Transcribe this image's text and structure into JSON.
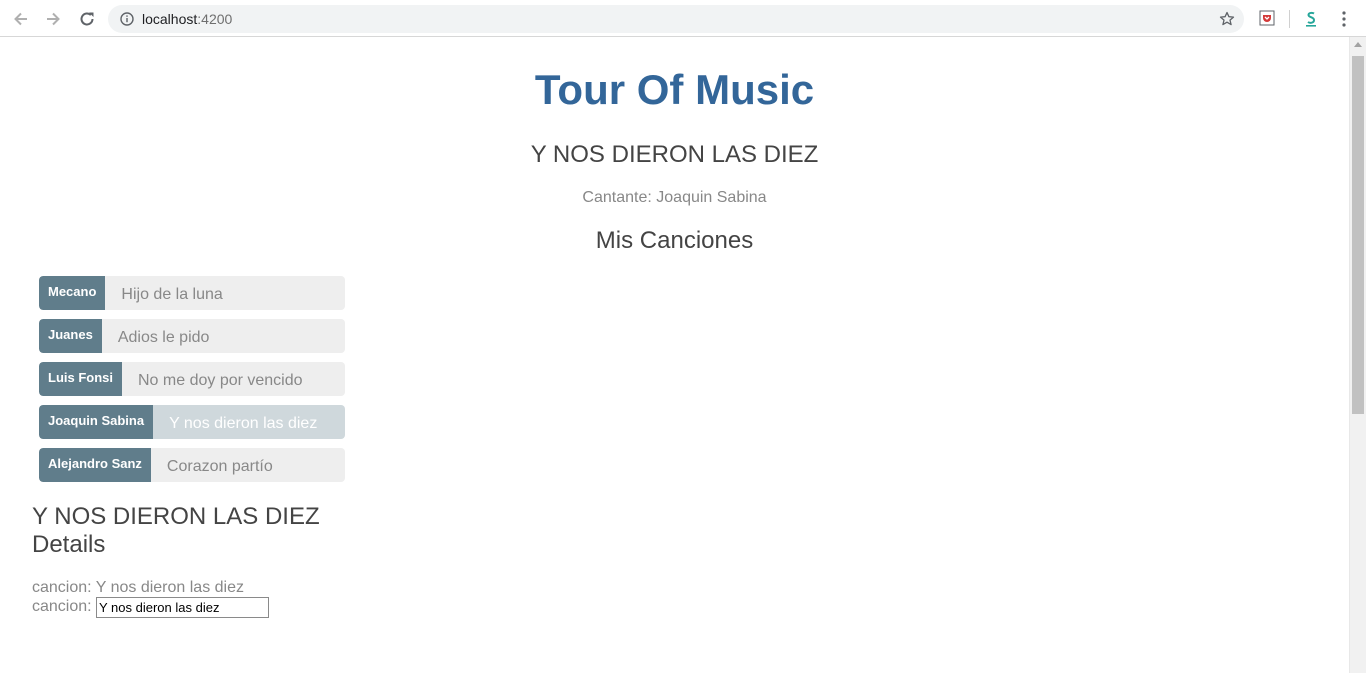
{
  "browser": {
    "url_host": "localhost",
    "url_port": ":4200"
  },
  "page": {
    "title": "Tour Of Music",
    "selected_song_heading": "Y NOS DIERON LAS DIEZ",
    "singer_label": "Cantante:",
    "singer_name": "Joaquin Sabina",
    "list_heading": "Mis Canciones",
    "songs": [
      {
        "artist": "Mecano",
        "name": "Hijo de la luna",
        "selected": false
      },
      {
        "artist": "Juanes",
        "name": "Adios le pido",
        "selected": false
      },
      {
        "artist": "Luis Fonsi",
        "name": "No me doy por vencido",
        "selected": false
      },
      {
        "artist": "Joaquin Sabina",
        "name": "Y nos dieron las diez",
        "selected": true
      },
      {
        "artist": "Alejandro Sanz",
        "name": "Corazon partío",
        "selected": false
      }
    ],
    "details": {
      "title_line1": "Y NOS DIERON LAS DIEZ",
      "title_line2": "Details",
      "cancion_label": "cancion:",
      "cancion_value": "Y nos dieron las diez",
      "input_label": "cancion:",
      "input_value": "Y nos dieron las diez"
    }
  },
  "colors": {
    "title": "#336699",
    "badge": "#607d8b",
    "item_bg": "#eeeeee",
    "item_selected_bg": "#cfd8dc"
  }
}
